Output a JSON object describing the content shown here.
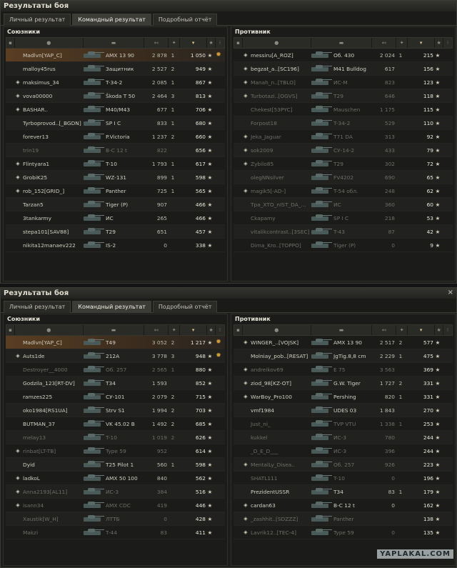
{
  "window_title": "Результаты боя",
  "close_icon_label": "×",
  "tabs": [
    "Личный результат",
    "Командный результат",
    "Подробный отчёт"
  ],
  "ally_title": "Союзники",
  "enemy_title": "Противник",
  "battles": [
    {
      "allies": [
        {
          "name": "Madlvn[YAP_C]",
          "tank": "AMX 13 90",
          "dmg": "2 878",
          "kills": "1",
          "xp": "1 050",
          "me": true,
          "medal": true
        },
        {
          "name": "malloy45rus",
          "tank": "Защитник",
          "dmg": "2 527",
          "kills": "2",
          "xp": "949"
        },
        {
          "name": "maksimus_34",
          "tank": "T-34-2",
          "dmg": "2 085",
          "kills": "1",
          "xp": "867",
          "dia": true
        },
        {
          "name": "vova00000",
          "tank": "Škoda T 50",
          "dmg": "2 464",
          "kills": "3",
          "xp": "813",
          "dia": true
        },
        {
          "name": "BASHAR..",
          "tank": "M40/M43",
          "dmg": "677",
          "kills": "1",
          "xp": "706",
          "dia": true
        },
        {
          "name": "Tyrboprovod..[_BGDN]",
          "tank": "SP I C",
          "dmg": "833",
          "kills": "1",
          "xp": "680"
        },
        {
          "name": "forever13",
          "tank": "P.Victoria",
          "dmg": "1 237",
          "kills": "2",
          "xp": "660"
        },
        {
          "name": "trin19",
          "tank": "B-C 12 t",
          "dmg": "822",
          "kills": "",
          "xp": "656",
          "dead": true
        },
        {
          "name": "Flintyara1",
          "tank": "T-10",
          "dmg": "1 793",
          "kills": "1",
          "xp": "617",
          "dia": true
        },
        {
          "name": "GrobiK25",
          "tank": "WZ-131",
          "dmg": "899",
          "kills": "1",
          "xp": "598",
          "dia": true
        },
        {
          "name": "rob_152[GRID_]",
          "tank": "Panther",
          "dmg": "725",
          "kills": "1",
          "xp": "565",
          "dia": true
        },
        {
          "name": "Tarzan5",
          "tank": "Tiger (P)",
          "dmg": "907",
          "kills": "",
          "xp": "466"
        },
        {
          "name": "3tankarmy",
          "tank": "ИС",
          "dmg": "265",
          "kills": "",
          "xp": "466"
        },
        {
          "name": "stepa101[SAV88]",
          "tank": "T29",
          "dmg": "651",
          "kills": "",
          "xp": "457"
        },
        {
          "name": "nikita12manaev222",
          "tank": "IS-2",
          "dmg": "0",
          "kills": "",
          "xp": "338"
        }
      ],
      "enemies": [
        {
          "name": "messiru[A_ROZ]",
          "tank": "Об. 430",
          "dmg": "2 024",
          "kills": "1",
          "xp": "215",
          "dia": true
        },
        {
          "name": "begzat_a..[SC196]",
          "tank": "M41 Bulldog",
          "dmg": "617",
          "kills": "",
          "xp": "156",
          "dia": true
        },
        {
          "name": "Manah_n..[TBLO]",
          "tank": "ИС-М",
          "dmg": "823",
          "kills": "",
          "xp": "123",
          "dia": true,
          "dead": true
        },
        {
          "name": "Turbotazi..[OGVS]",
          "tank": "T29",
          "dmg": "646",
          "kills": "",
          "xp": "118",
          "dia": true,
          "dead": true
        },
        {
          "name": "Chekest[53PYC]",
          "tank": "Mauschen",
          "dmg": "1 175",
          "kills": "",
          "xp": "115",
          "dead": true
        },
        {
          "name": "Forpost18",
          "tank": "T-34-2",
          "dmg": "529",
          "kills": "",
          "xp": "110",
          "dead": true
        },
        {
          "name": "Jeka_Jaguar",
          "tank": "T71 DA",
          "dmg": "313",
          "kills": "",
          "xp": "92",
          "dia": true,
          "dead": true
        },
        {
          "name": "sok2009",
          "tank": "СУ-14-2",
          "dmg": "433",
          "kills": "",
          "xp": "79",
          "dia": true,
          "dead": true
        },
        {
          "name": "Zybilo85",
          "tank": "T29",
          "dmg": "302",
          "kills": "",
          "xp": "72",
          "dia": true,
          "dead": true
        },
        {
          "name": "olegNNsilver",
          "tank": "FV4202",
          "dmg": "690",
          "kills": "",
          "xp": "65",
          "dead": true
        },
        {
          "name": "magik5[-AD-]",
          "tank": "T-54 обл.",
          "dmg": "248",
          "kills": "",
          "xp": "62",
          "dia": true,
          "dead": true
        },
        {
          "name": "Tpa_XTO_nIST_DA_...",
          "tank": "ИС",
          "dmg": "360",
          "kills": "",
          "xp": "60",
          "dead": true
        },
        {
          "name": "Ckapamy",
          "tank": "SP I C",
          "dmg": "218",
          "kills": "",
          "xp": "53",
          "dead": true
        },
        {
          "name": "vitalikcontrast..[3SEC]",
          "tank": "T-43",
          "dmg": "87",
          "kills": "",
          "xp": "42",
          "dead": true
        },
        {
          "name": "Dima_Kro..[TOPPO]",
          "tank": "Tiger (P)",
          "dmg": "0",
          "kills": "",
          "xp": "9",
          "dead": true
        }
      ]
    },
    {
      "allies": [
        {
          "name": "Madlvn[YAP_C]",
          "tank": "T49",
          "dmg": "3 052",
          "kills": "2",
          "xp": "1 217",
          "me": true,
          "medal": true
        },
        {
          "name": "Auts1de",
          "tank": "212A",
          "dmg": "3 778",
          "kills": "3",
          "xp": "948",
          "dia": true,
          "medal": true
        },
        {
          "name": "Destroyer__4000",
          "tank": "Об. 257",
          "dmg": "2 565",
          "kills": "1",
          "xp": "880",
          "dead": true
        },
        {
          "name": "Godzila_123[RT-DV]",
          "tank": "T34",
          "dmg": "1 593",
          "kills": "",
          "xp": "852"
        },
        {
          "name": "ramzes225",
          "tank": "СУ-101",
          "dmg": "2 079",
          "kills": "2",
          "xp": "715"
        },
        {
          "name": "oko1984[RS1UA]",
          "tank": "Strv S1",
          "dmg": "1 994",
          "kills": "2",
          "xp": "703"
        },
        {
          "name": "BUTMAN_37",
          "tank": "VK 45.02 B",
          "dmg": "1 492",
          "kills": "2",
          "xp": "685"
        },
        {
          "name": "melay13",
          "tank": "T-10",
          "dmg": "1 019",
          "kills": "2",
          "xp": "626",
          "dead": true
        },
        {
          "name": "rinbat[LT-TB]",
          "tank": "Type 59",
          "dmg": "952",
          "kills": "",
          "xp": "614",
          "dia": true,
          "dead": true
        },
        {
          "name": "Dyid",
          "tank": "T25 Pilot 1",
          "dmg": "560",
          "kills": "1",
          "xp": "598"
        },
        {
          "name": "ladkoL",
          "tank": "AMX 50 100",
          "dmg": "840",
          "kills": "",
          "xp": "562",
          "dia": true
        },
        {
          "name": "Anna2193[AL11]",
          "tank": "ИС-3",
          "dmg": "384",
          "kills": "",
          "xp": "516",
          "dia": true,
          "dead": true
        },
        {
          "name": "isann34",
          "tank": "AMX CDC",
          "dmg": "419",
          "kills": "",
          "xp": "446",
          "dia": true,
          "dead": true
        },
        {
          "name": "Xaustik[W_H]",
          "tank": "ЛТТБ",
          "dmg": "0",
          "kills": "",
          "xp": "428",
          "dead": true
        },
        {
          "name": "Makzi",
          "tank": "T-44",
          "dmg": "83",
          "kills": "",
          "xp": "411",
          "dead": true
        }
      ],
      "enemies": [
        {
          "name": "WINGER_..[VOJSK]",
          "tank": "AMX 13 90",
          "dmg": "2 517",
          "kills": "2",
          "xp": "577",
          "dia": true
        },
        {
          "name": "Molniay_pob..[RESAT]",
          "tank": "JgTig.8,8 cm",
          "dmg": "2 229",
          "kills": "1",
          "xp": "475"
        },
        {
          "name": "andreikov69",
          "tank": "E 75",
          "dmg": "3 563",
          "kills": "",
          "xp": "369",
          "dia": true,
          "dead": true
        },
        {
          "name": "ziod_98[KZ-OT]",
          "tank": "G.W. Tiger",
          "dmg": "1 727",
          "kills": "2",
          "xp": "331",
          "dia": true
        },
        {
          "name": "WarBoy_Pro100",
          "tank": "Pershing",
          "dmg": "820",
          "kills": "1",
          "xp": "331",
          "dia": true
        },
        {
          "name": "vmf1984",
          "tank": "UDES 03",
          "dmg": "1 843",
          "kills": "",
          "xp": "270"
        },
        {
          "name": "Just_ni_",
          "tank": "TVP VTU",
          "dmg": "1 338",
          "kills": "1",
          "xp": "253",
          "dead": true
        },
        {
          "name": "kukkel",
          "tank": "ИС-3",
          "dmg": "780",
          "kills": "",
          "xp": "244",
          "dead": true
        },
        {
          "name": "_D_E_D___",
          "tank": "ИС-3",
          "dmg": "396",
          "kills": "",
          "xp": "244",
          "dead": true
        },
        {
          "name": "MentalLy_Disea..",
          "tank": "Об. 257",
          "dmg": "926",
          "kills": "",
          "xp": "223",
          "dia": true,
          "dead": true
        },
        {
          "name": "SHATL111",
          "tank": "T-10",
          "dmg": "0",
          "kills": "",
          "xp": "196",
          "dead": true
        },
        {
          "name": "PrezidentUSSR",
          "tank": "T34",
          "dmg": "83",
          "kills": "1",
          "xp": "179"
        },
        {
          "name": "cardan63",
          "tank": "B-C 12 t",
          "dmg": "0",
          "kills": "",
          "xp": "162",
          "dia": true
        },
        {
          "name": "_zashhit..[SDZZZ]",
          "tank": "Panther",
          "dmg": "",
          "kills": "",
          "xp": "138",
          "dia": true,
          "dead": true
        },
        {
          "name": "Lavrik12..[TEC-4]",
          "tank": "Type 59",
          "dmg": "0",
          "kills": "",
          "xp": "135",
          "dia": true,
          "dead": true
        }
      ]
    }
  ],
  "watermark": "YAPLAKAL.COM"
}
